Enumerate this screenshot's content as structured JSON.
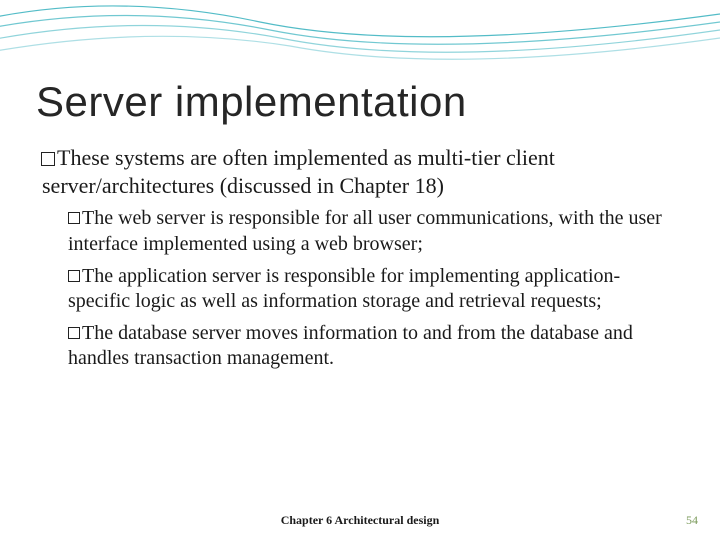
{
  "heading": "Server implementation",
  "top_item": "These systems are often implemented as multi-tier client server/architectures (discussed in Chapter 18)",
  "sub_items": [
    "The web server is responsible for all user communications, with the user interface implemented using a web browser;",
    "The application server is responsible for implementing application-specific logic as well as information storage and retrieval requests;",
    "The database server moves information to and from the database and handles transaction management."
  ],
  "footer": "Chapter 6 Architectural design",
  "page_number": "54"
}
